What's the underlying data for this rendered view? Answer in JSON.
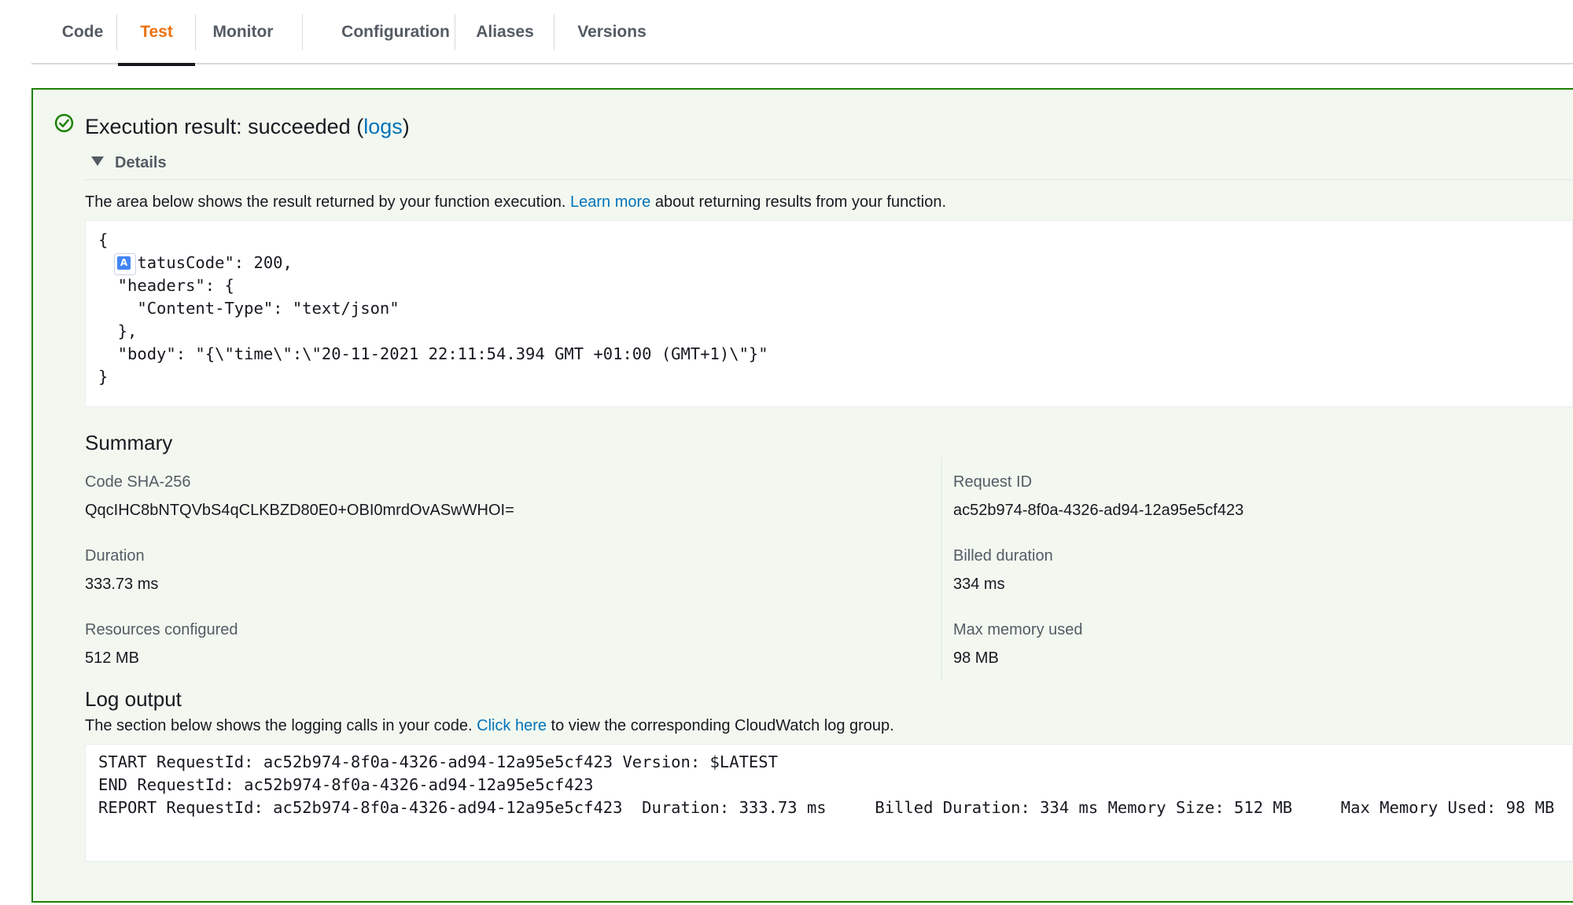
{
  "tabs": [
    {
      "label": "Code"
    },
    {
      "label": "Test",
      "active": true
    },
    {
      "label": "Monitor"
    },
    {
      "label": "Configuration"
    },
    {
      "label": "Aliases"
    },
    {
      "label": "Versions"
    }
  ],
  "result": {
    "status_icon": "check-circle-icon",
    "title_prefix": "Execution result: succeeded (",
    "logs_link": "logs",
    "title_suffix": ")",
    "details_label": "Details",
    "description_prefix": "The area below shows the result returned by your function execution. ",
    "learn_more_link": "Learn more",
    "description_suffix": " about returning results from your function.",
    "response_json": "{\n  \"statusCode\": 200,\n  \"headers\": {\n    \"Content-Type\": \"text/json\"\n  },\n  \"body\": \"{\\\"time\\\":\\\"20-11-2021 22:11:54.394 GMT +01:00 (GMT+1)\\\"}\"\n}"
  },
  "summary": {
    "title": "Summary",
    "code_sha_label": "Code SHA-256",
    "code_sha_value": "QqcIHC8bNTQVbS4qCLKBZD80E0+OBI0mrdOvASwWHOI=",
    "request_id_label": "Request ID",
    "request_id_value": "ac52b974-8f0a-4326-ad94-12a95e5cf423",
    "duration_label": "Duration",
    "duration_value": "333.73 ms",
    "billed_duration_label": "Billed duration",
    "billed_duration_value": "334 ms",
    "resources_label": "Resources configured",
    "resources_value": "512 MB",
    "max_memory_label": "Max memory used",
    "max_memory_value": "98 MB"
  },
  "log_output": {
    "title": "Log output",
    "description_prefix": "The section below shows the logging calls in your code. ",
    "click_here_link": "Click here",
    "description_suffix": " to view the corresponding CloudWatch log group.",
    "log_text": "START RequestId: ac52b974-8f0a-4326-ad94-12a95e5cf423 Version: $LATEST\nEND RequestId: ac52b974-8f0a-4326-ad94-12a95e5cf423\nREPORT RequestId: ac52b974-8f0a-4326-ad94-12a95e5cf423  Duration: 333.73 ms     Billed Duration: 334 ms Memory Size: 512 MB     Max Memory Used: 98 MB"
  },
  "colors": {
    "accent_tab": "#ec7211",
    "success_border": "#1d8102",
    "panel_bg": "#f2f8f0",
    "link": "#0073bb"
  }
}
